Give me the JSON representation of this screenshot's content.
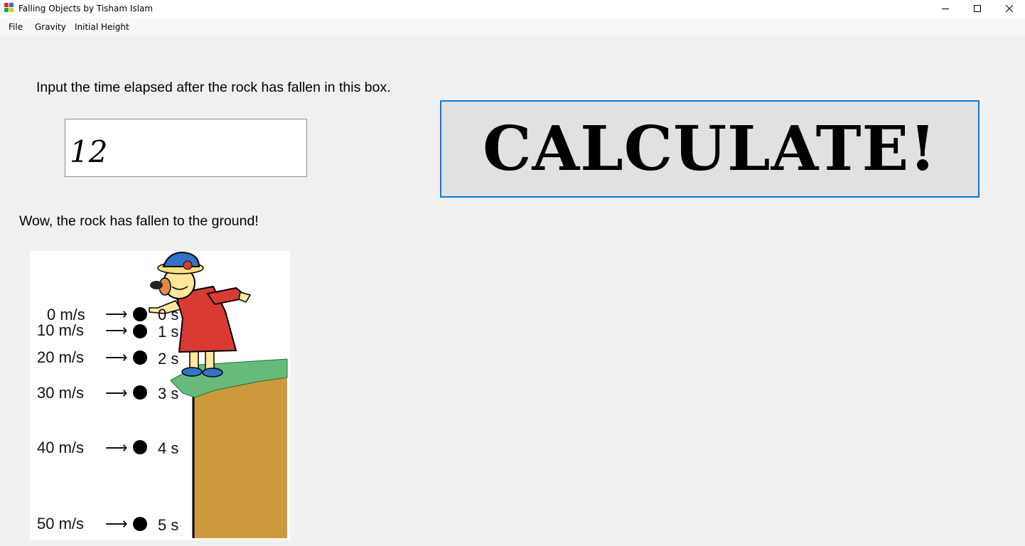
{
  "window": {
    "title": "Falling Objects by Tisham Islam",
    "controls": [
      "minimize-icon",
      "maximize-icon",
      "close-icon"
    ]
  },
  "menu": {
    "items": [
      "File",
      "Gravity",
      "Initial Height"
    ]
  },
  "instruction": "Input the time elapsed after the rock has fallen in this box.",
  "time_input": {
    "value": "12"
  },
  "calculate_button": {
    "label": "CALCULATE!"
  },
  "result_text": "Wow, the rock has fallen to the ground!",
  "illustration": {
    "rows": [
      {
        "speed": "0 m/s",
        "time": "0 s"
      },
      {
        "speed": "10 m/s",
        "time": "1 s"
      },
      {
        "speed": "20 m/s",
        "time": "2 s"
      },
      {
        "speed": "30 m/s",
        "time": "3 s"
      },
      {
        "speed": "40 m/s",
        "time": "4 s"
      },
      {
        "speed": "50 m/s",
        "time": "5 s"
      }
    ]
  },
  "colors": {
    "accent": "#0a78d7",
    "cliff_dirt": "#cc9a3c",
    "cliff_grass": "#66bb7a",
    "dress": "#d93b32"
  }
}
